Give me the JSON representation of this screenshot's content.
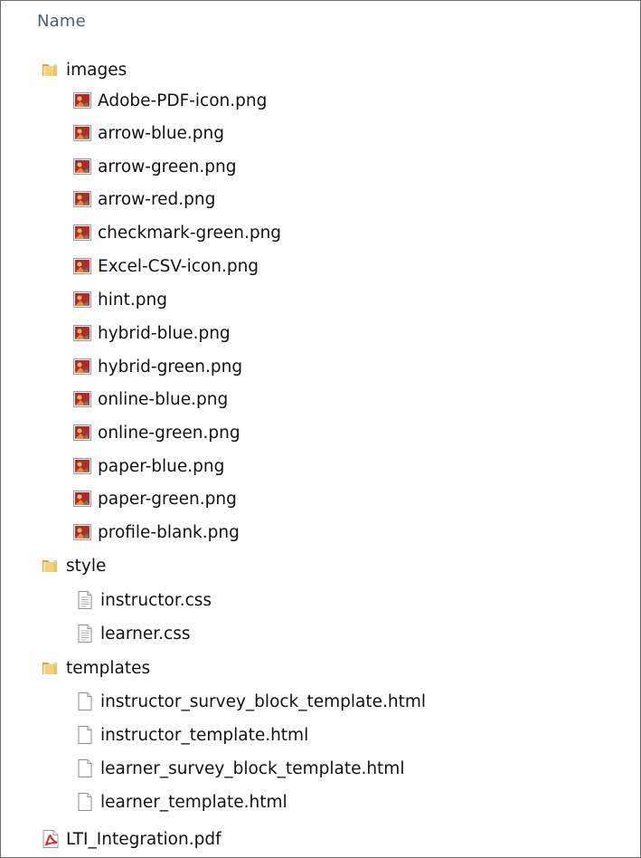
{
  "header": {
    "name_column": "Name"
  },
  "tree": [
    {
      "name": "images",
      "type": "folder",
      "level": 0
    },
    {
      "name": "Adobe-PDF-icon.png",
      "type": "image",
      "level": 1
    },
    {
      "name": "arrow-blue.png",
      "type": "image",
      "level": 1
    },
    {
      "name": "arrow-green.png",
      "type": "image",
      "level": 1
    },
    {
      "name": "arrow-red.png",
      "type": "image",
      "level": 1
    },
    {
      "name": "checkmark-green.png",
      "type": "image",
      "level": 1
    },
    {
      "name": "Excel-CSV-icon.png",
      "type": "image",
      "level": 1
    },
    {
      "name": "hint.png",
      "type": "image",
      "level": 1
    },
    {
      "name": "hybrid-blue.png",
      "type": "image",
      "level": 1
    },
    {
      "name": "hybrid-green.png",
      "type": "image",
      "level": 1
    },
    {
      "name": "online-blue.png",
      "type": "image",
      "level": 1
    },
    {
      "name": "online-green.png",
      "type": "image",
      "level": 1
    },
    {
      "name": "paper-blue.png",
      "type": "image",
      "level": 1
    },
    {
      "name": "paper-green.png",
      "type": "image",
      "level": 1
    },
    {
      "name": "profile-blank.png",
      "type": "image",
      "level": 1
    },
    {
      "name": "style",
      "type": "folder",
      "level": 0
    },
    {
      "name": "instructor.css",
      "type": "text",
      "level": 1
    },
    {
      "name": "learner.css",
      "type": "text",
      "level": 1
    },
    {
      "name": "templates",
      "type": "folder",
      "level": 0
    },
    {
      "name": "instructor_survey_block_template.html",
      "type": "html",
      "level": 1
    },
    {
      "name": "instructor_template.html",
      "type": "html",
      "level": 1
    },
    {
      "name": "learner_survey_block_template.html",
      "type": "html",
      "level": 1
    },
    {
      "name": "learner_template.html",
      "type": "html",
      "level": 1
    },
    {
      "name": "LTI_Integration.pdf",
      "type": "pdf",
      "level": 0
    }
  ],
  "icons": {
    "folder": "folder-icon",
    "image": "image-file-icon",
    "text": "text-file-icon",
    "html": "html-file-icon",
    "pdf": "pdf-file-icon"
  },
  "colors": {
    "header_text": "#4c607a",
    "folder_yellow": "#e8c66a",
    "image_red": "#c1272d",
    "pdf_red": "#d32f2f"
  }
}
